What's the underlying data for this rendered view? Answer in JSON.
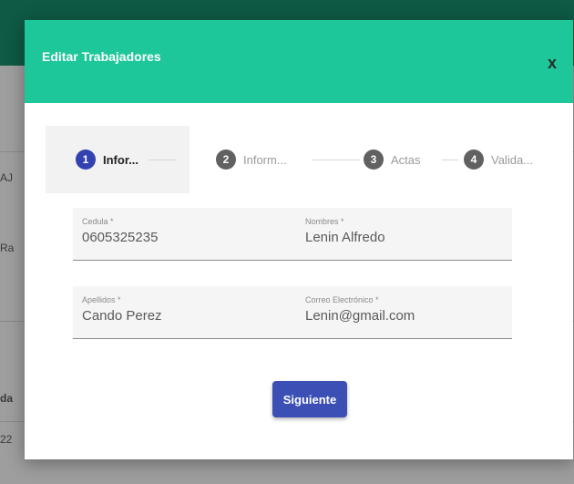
{
  "background": {
    "fragments": [
      "AJ",
      "Ra",
      "da",
      "22"
    ]
  },
  "modal": {
    "title": "Editar Trabajadores",
    "close_icon": "close-icon",
    "close_glyph": "x"
  },
  "stepper": {
    "active_index": 0,
    "colors": {
      "active": "#3342b0",
      "inactive": "#616161"
    },
    "steps": [
      {
        "number": "1",
        "label": "Infor..."
      },
      {
        "number": "2",
        "label": "Inform..."
      },
      {
        "number": "3",
        "label": "Actas"
      },
      {
        "number": "4",
        "label": "Valida..."
      }
    ]
  },
  "form": {
    "cedula": {
      "label": "Cedula *",
      "value": "0605325235"
    },
    "nombres": {
      "label": "Nombres *",
      "value": "Lenin Alfredo"
    },
    "apellidos": {
      "label": "Apellidos *",
      "value": "Cando Perez"
    },
    "correo": {
      "label": "Correo Electrónico *",
      "value": "Lenin@gmail.com"
    }
  },
  "actions": {
    "next_label": "Siguiente"
  },
  "colors": {
    "header": "#1ec79a",
    "primary_button": "#3b4fb4"
  }
}
